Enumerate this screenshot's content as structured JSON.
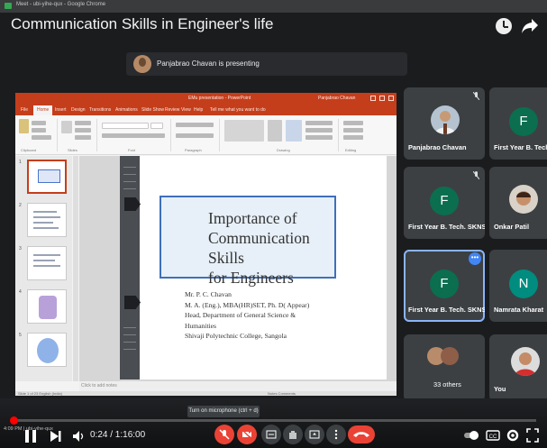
{
  "chrome": {
    "app_title": "Meet - ubi-yihe-qux - Google Chrome"
  },
  "video": {
    "title": "Communication Skills in Engineer's life"
  },
  "presenting": {
    "text": "Panjabrao Chavan is presenting"
  },
  "ppt": {
    "doc_title": "EMu presentation - PowerPoint",
    "user_name": "Panjabrao Chavan",
    "tabs": [
      "File",
      "Home",
      "Insert",
      "Design",
      "Transitions",
      "Animations",
      "Slide Show",
      "Review",
      "View",
      "Help",
      "Tell me what you want to do"
    ],
    "ribbon_groups": [
      "Clipboard",
      "Slides",
      "Font",
      "Paragraph",
      "Drawing",
      "Editing"
    ],
    "slide": {
      "title_lines": [
        "Importance of",
        "Communication Skills",
        "for Engineers"
      ],
      "speaker_lines": [
        "Mr. P. C. Chavan",
        "M. A. (Eng.),  MBA(HR)SET, Ph. D( Appear)",
        "Head, Department of General Science &",
        "Humanities",
        "Shivaji Polytechnic College, Sangola"
      ]
    },
    "notes_placeholder": "Click to add notes",
    "status_left": "Slide 1 of 23   English (India)",
    "status_right": "Notes   Comments"
  },
  "participants": [
    {
      "name": "Panjabrao Chavan",
      "kind": "photo",
      "muted": true
    },
    {
      "name": "First Year B. Tech",
      "kind": "letter",
      "letter": "F",
      "color": "#0b6e4f"
    },
    {
      "name": "First Year B. Tech. SKNS...",
      "kind": "letter",
      "letter": "F",
      "color": "#0b6e4f",
      "muted": true
    },
    {
      "name": "Onkar Patil",
      "kind": "photo"
    },
    {
      "name": "First Year B. Tech. SKNS...",
      "kind": "letter",
      "letter": "F",
      "color": "#0b6e4f",
      "active": true
    },
    {
      "name": "Namrata Kharat",
      "kind": "letter",
      "letter": "N",
      "color": "#008c7e"
    },
    {
      "name": "33 others",
      "kind": "group"
    },
    {
      "name": "You",
      "kind": "photo"
    }
  ],
  "mic_tooltip": "Turn on microphone (ctrl + d)",
  "player": {
    "current_time": "0:24",
    "duration": "1:16:00",
    "time_display": "0:24 / 1:16:00",
    "progress_fraction": 0.005,
    "overlay_text": "4:09 PM | ubi-yihe-qux"
  },
  "colors": {
    "ppt_accent": "#c43e1c",
    "slide_box_border": "#3f6fba",
    "meet_red": "#ea4335",
    "tile_bg": "#3c4043",
    "progress_red": "#ff0000"
  },
  "icons": [
    "meet-icon",
    "clock-icon",
    "share-icon",
    "mic-off-icon",
    "cam-off-icon",
    "captions-icon",
    "raise-hand-icon",
    "present-icon",
    "more-icon",
    "end-call-icon",
    "play-pause-icon",
    "next-icon",
    "volume-icon",
    "autoplay-icon",
    "cc-icon",
    "settings-icon",
    "fullscreen-icon"
  ]
}
